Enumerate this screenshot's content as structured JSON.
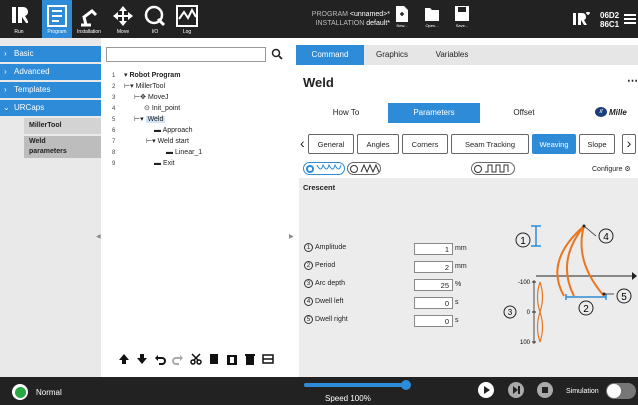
{
  "nav": {
    "run": "Run",
    "program": "Program",
    "installation": "Installation",
    "move": "Move",
    "io": "I/O",
    "log": "Log"
  },
  "program_info": {
    "program_label": "PROGRAM",
    "program_value": "<unnamed>*",
    "installation_label": "INSTALLATION",
    "installation_value": "default*"
  },
  "file": {
    "new": "New...",
    "open": "Open...",
    "save": "Save..."
  },
  "serial": {
    "line1": "06D2",
    "line2": "86C1"
  },
  "sidebar": {
    "basic": "Basic",
    "advanced": "Advanced",
    "templates": "Templates",
    "urcaps": "URCaps",
    "sub1": "MillerTool",
    "sub2a": "Weld",
    "sub2b": "parameters"
  },
  "tree": [
    {
      "n": "1",
      "t": "Robot Program"
    },
    {
      "n": "2",
      "t": "MillerTool"
    },
    {
      "n": "3",
      "t": "MoveJ"
    },
    {
      "n": "4",
      "t": "Init_point"
    },
    {
      "n": "5",
      "t": "Weld"
    },
    {
      "n": "6",
      "t": "Approach"
    },
    {
      "n": "7",
      "t": "Weld start"
    },
    {
      "n": "8",
      "t": "Linear_1"
    },
    {
      "n": "9",
      "t": "Exit"
    }
  ],
  "tabs": {
    "command": "Command",
    "graphics": "Graphics",
    "variables": "Variables"
  },
  "node_title": "Weld",
  "subtabs": {
    "howto": "How To",
    "parameters": "Parameters",
    "offset": "Offset",
    "brand": "Mille"
  },
  "weldtabs": [
    "General",
    "Angles",
    "Corners",
    "Seam Tracking",
    "Weaving",
    "Slope"
  ],
  "weave": {
    "name": "Crescent",
    "configure": "Configure"
  },
  "params": [
    {
      "n": "1",
      "label": "Amplitude",
      "value": "1",
      "unit": "mm"
    },
    {
      "n": "2",
      "label": "Period",
      "value": "2",
      "unit": "mm"
    },
    {
      "n": "3",
      "label": "Arc depth",
      "value": "25",
      "unit": "%"
    },
    {
      "n": "4",
      "label": "Dwell left",
      "value": "0",
      "unit": "s"
    },
    {
      "n": "5",
      "label": "Dwell right",
      "value": "0",
      "unit": "s"
    }
  ],
  "diagram": {
    "n1": "1",
    "n2": "2",
    "n3": "3",
    "n4": "4",
    "n5": "5",
    "top": "-100",
    "mid": "0",
    "bot": "100"
  },
  "status": {
    "mode": "Normal",
    "speed": "Speed 100%",
    "sim": "Simulation",
    "speed_value": 100
  }
}
